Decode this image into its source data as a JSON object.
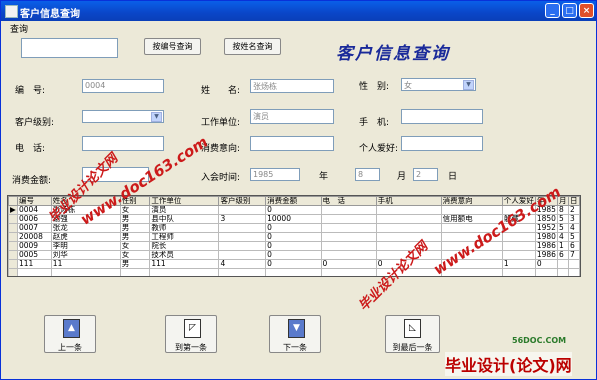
{
  "window": {
    "title": "客户信息查询"
  },
  "query": {
    "group_label": "查询",
    "keyword_value": "",
    "by_number_button": "按编号查询",
    "by_name_button": "按姓名查询",
    "big_title": "客户信息查询"
  },
  "form": {
    "number_label": "编　号:",
    "number_value": "0004",
    "name_label": "姓　　名:",
    "name_value": "张炀栋",
    "gender_label": "性　别:",
    "gender_value": "女",
    "level_label": "客户级别:",
    "level_value": "",
    "work_label": "工作单位:",
    "work_value": "演员",
    "mobile_label": "手　机:",
    "mobile_value": "",
    "phone_label": "电　话:",
    "phone_value": "",
    "intent_label": "消费意向:",
    "intent_value": "",
    "hobby_label": "个人爱好:",
    "hobby_value": "",
    "amount_label": "消费金额:",
    "amount_value": "",
    "join_label": "入会时间:",
    "year_value": "1985",
    "year_unit": "年",
    "month_value": "8",
    "month_unit": "月",
    "day_value": "2",
    "day_unit": "日"
  },
  "grid": {
    "headers": [
      "编号",
      "姓名",
      "性别",
      "工作单位",
      "客户级别",
      "消费金额",
      "电　话",
      "手机",
      "消费意向",
      "个人爱好",
      "年",
      "月",
      "日"
    ],
    "rows": [
      {
        "marker": "▶",
        "cells": [
          "0004",
          "张炀栋",
          "女",
          "演员",
          "",
          "0",
          "",
          "",
          "",
          "",
          "1985",
          "8",
          "2"
        ]
      },
      {
        "marker": "",
        "cells": [
          "0006",
          "谢强",
          "男",
          "县中队",
          "3",
          "10000",
          "",
          "",
          "信用额电",
          "躲藏",
          "1850",
          "5",
          "3"
        ]
      },
      {
        "marker": "",
        "cells": [
          "0007",
          "张龙",
          "男",
          "教师",
          "",
          "0",
          "",
          "",
          "",
          "",
          "1952",
          "5",
          "4"
        ]
      },
      {
        "marker": "",
        "cells": [
          "20008",
          "赵虎",
          "男",
          "工程师",
          "",
          "0",
          "",
          "",
          "",
          "",
          "1980",
          "4",
          "5"
        ]
      },
      {
        "marker": "",
        "cells": [
          "0009",
          "李明",
          "女",
          "院长",
          "",
          "0",
          "",
          "",
          "",
          "",
          "1986",
          "1",
          "6"
        ]
      },
      {
        "marker": "",
        "cells": [
          "0005",
          "刘华",
          "女",
          "技术员",
          "",
          "0",
          "",
          "",
          "",
          "",
          "1986",
          "6",
          "7"
        ]
      },
      {
        "marker": "",
        "cells": [
          "111",
          "11",
          "男",
          "111",
          "4",
          "0",
          "0",
          "0",
          "",
          "1",
          "0",
          "",
          ""
        ]
      },
      {
        "marker": "",
        "cells": [
          "",
          "",
          "",
          "",
          "",
          "",
          "",
          "",
          "",
          "",
          "",
          "",
          ""
        ]
      }
    ]
  },
  "nav": {
    "prev_label": "上一条",
    "first_label": "到第一条",
    "next_label": "下一条",
    "last_label": "到最后一条"
  },
  "watermarks": {
    "site": "www.doc163.com",
    "brand": "毕业设计论文网",
    "footer_brand": "毕业设计(论文)网",
    "footer_site": "56DOC.COM"
  },
  "colors": {
    "title_blue": "#0a46c8",
    "watermark_red": "#cc1a1a"
  }
}
